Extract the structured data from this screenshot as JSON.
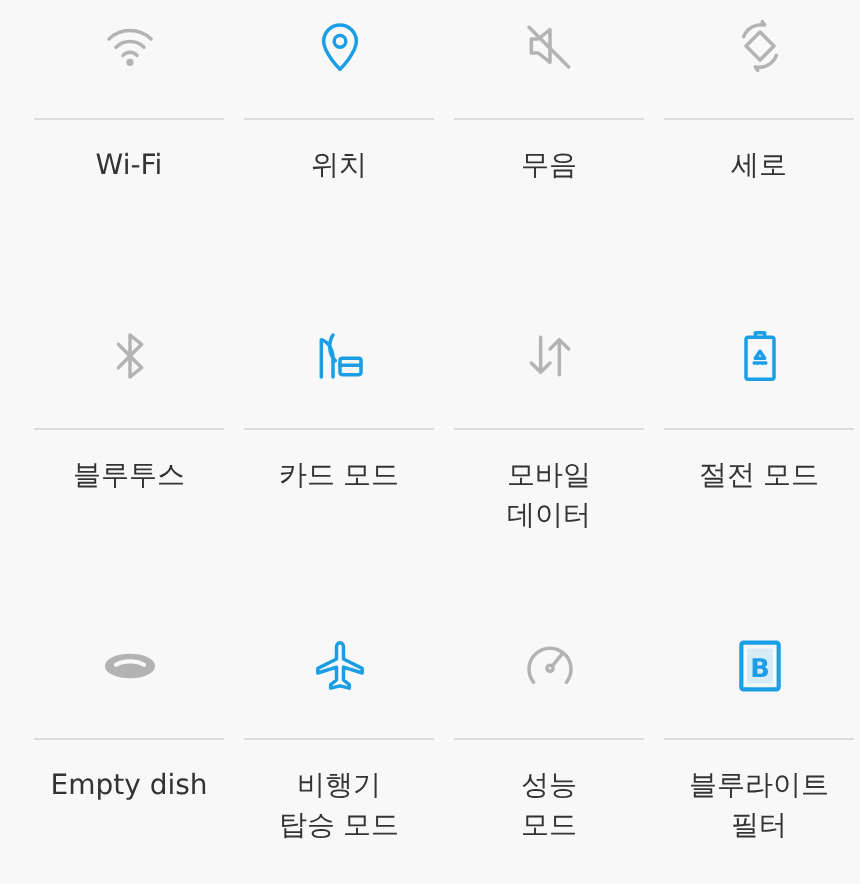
{
  "tiles": [
    {
      "label": "Wi-Fi",
      "on": false
    },
    {
      "label": "위치",
      "on": true
    },
    {
      "label": "무음",
      "on": false
    },
    {
      "label": "세로",
      "on": false
    },
    {
      "label": "블루투스",
      "on": false
    },
    {
      "label": "카드 모드",
      "on": true
    },
    {
      "label": "모바일\n데이터",
      "on": false
    },
    {
      "label": "절전 모드",
      "on": true
    },
    {
      "label": "Empty dish",
      "on": false
    },
    {
      "label": "비행기\n탑승 모드",
      "on": true
    },
    {
      "label": "성능\n모드",
      "on": false
    },
    {
      "label": "블루라이트\n필터",
      "on": true,
      "icon_text": "B"
    }
  ]
}
